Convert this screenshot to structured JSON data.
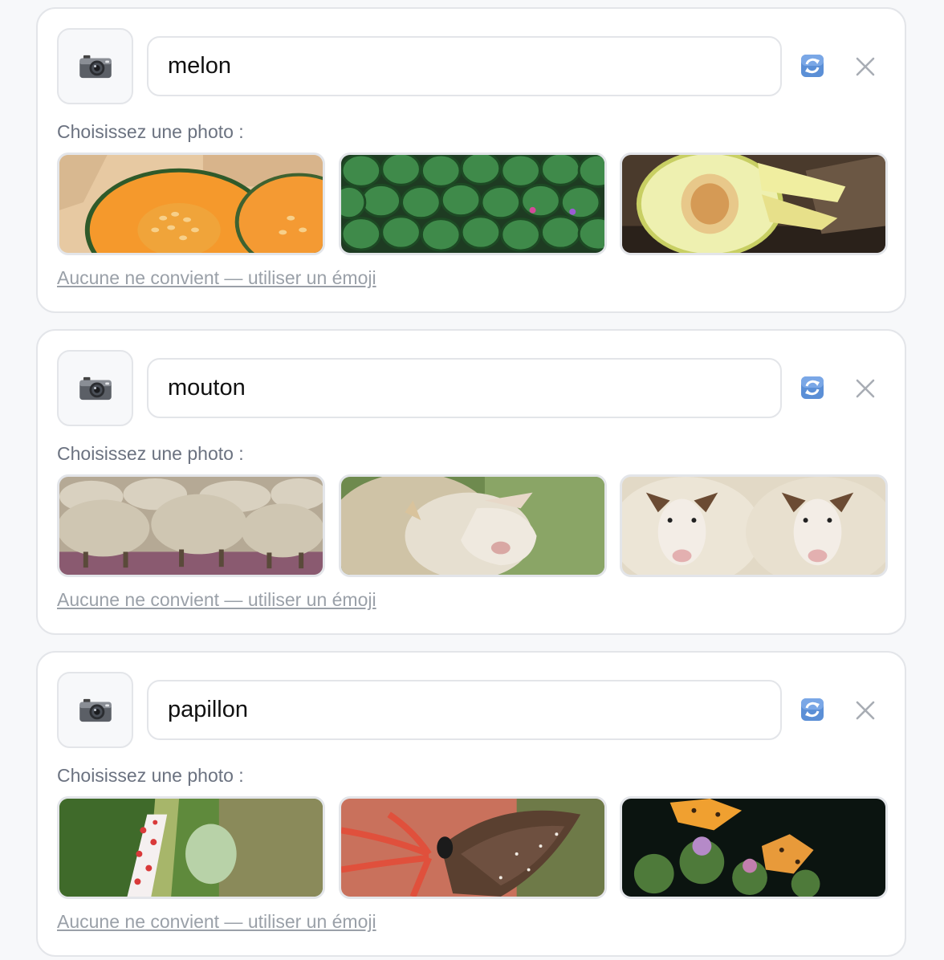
{
  "cards": [
    {
      "word": "melon",
      "prompt": "Choisissez une photo :",
      "fallback": "Aucune ne convient — utiliser un émoji",
      "thumb_icon": "camera-icon",
      "photos": [
        "cantaloupe-halves-photo",
        "watermelons-pile-photo",
        "honeydew-melon-photo"
      ]
    },
    {
      "word": "mouton",
      "prompt": "Choisissez une photo :",
      "fallback": "Aucune ne convient — utiliser un émoji",
      "thumb_icon": "camera-icon",
      "photos": [
        "grazing-sheep-flock-photo",
        "sheep-closeup-photo",
        "two-sheep-faces-photo"
      ]
    },
    {
      "word": "papillon",
      "prompt": "Choisissez une photo :",
      "fallback": "Aucune ne convient — utiliser un émoji",
      "thumb_icon": "camera-icon",
      "photos": [
        "moth-on-stem-photo",
        "brown-butterfly-red-flower-photo",
        "orange-butterflies-thistle-photo"
      ]
    }
  ],
  "icons": {
    "refresh": "refresh-icon",
    "close": "close-icon"
  },
  "colors": {
    "border": "#e3e5e9",
    "muted_text": "#6b7280",
    "link": "#9aa0a8",
    "refresh_blue": "#5b8fd6"
  }
}
